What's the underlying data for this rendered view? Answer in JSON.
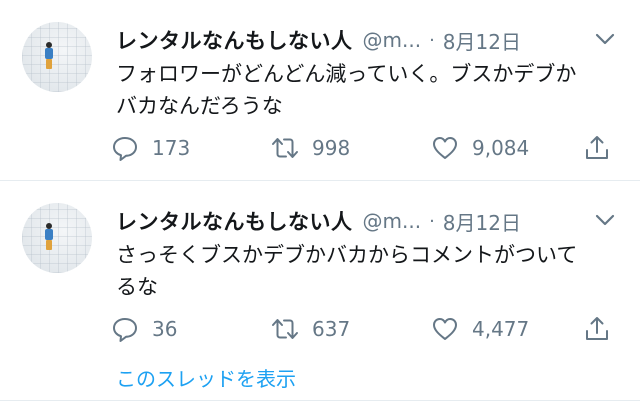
{
  "tweets": [
    {
      "author_name": "レンタルなんもしない人",
      "handle": "@m...",
      "date": "8月12日",
      "text": "フォロワーがどんどん減っていく。ブスかデブかバカなんだろうな",
      "replies": "173",
      "retweets": "998",
      "likes": "9,084"
    },
    {
      "author_name": "レンタルなんもしない人",
      "handle": "@m...",
      "date": "8月12日",
      "text": "さっそくブスかデブかバカからコメントがついてるな",
      "replies": "36",
      "retweets": "637",
      "likes": "4,477"
    }
  ],
  "separator": "·",
  "thread_link": "このスレッドを表示",
  "colors": {
    "accent": "#1da1f2",
    "secondary_text": "#657786",
    "divider": "#e6ecf0"
  },
  "icons": [
    "avatar",
    "chevron-down-icon",
    "reply-icon",
    "retweet-icon",
    "like-icon",
    "share-icon"
  ]
}
